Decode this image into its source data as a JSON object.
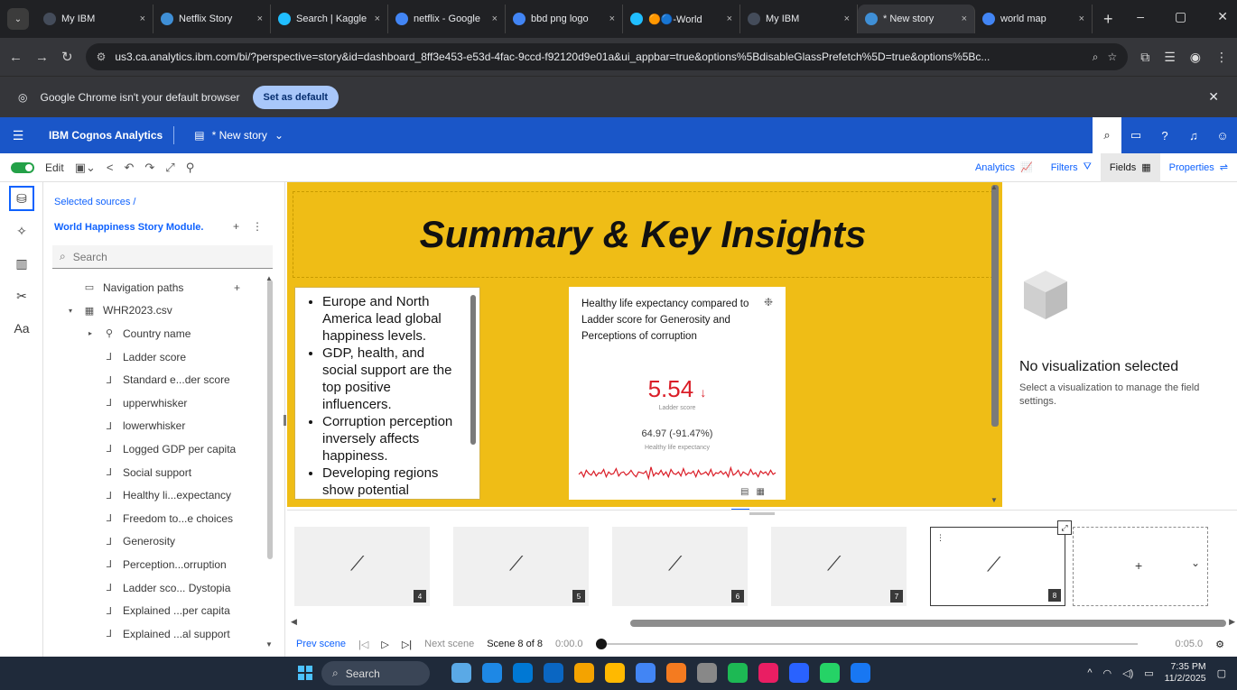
{
  "browser": {
    "tabs": [
      {
        "label": "My IBM",
        "color": "#444c5a",
        "active": false
      },
      {
        "label": "Netflix Story",
        "color": "#3f8fd6",
        "active": false
      },
      {
        "label": "Search | Kaggle",
        "color": "#20beff",
        "active": false
      },
      {
        "label": "netflix - Google",
        "color": "#4285f4",
        "active": false
      },
      {
        "label": "bbd png logo",
        "color": "#4285f4",
        "active": false
      },
      {
        "label": "🟠🔵-World",
        "color": "#20beff",
        "active": false
      },
      {
        "label": "My IBM",
        "color": "#444c5a",
        "active": false
      },
      {
        "label": "* New story",
        "color": "#3f8fd6",
        "active": true
      },
      {
        "label": "world map",
        "color": "#4285f4",
        "active": false
      }
    ],
    "tab_close": "×",
    "new_tab": "+",
    "window_controls": [
      "–",
      "▢",
      "✕"
    ],
    "url": "us3.ca.analytics.ibm.com/bi/?perspective=story&id=dashboard_8ff3e453-e53d-4fac-9ccd-f92120d9e01a&ui_appbar=true&options%5BdisableGlassPrefetch%5D=true&options%5Bc...",
    "infobar_text": "Google Chrome isn't your default browser",
    "set_default_label": "Set as default"
  },
  "app": {
    "product": "IBM Cognos Analytics",
    "story_name": "* New story"
  },
  "toolbar": {
    "edit_label": "Edit",
    "tabs": [
      {
        "label": "Analytics",
        "icon": "📈",
        "active": false
      },
      {
        "label": "Filters",
        "icon": "⛛",
        "active": false
      },
      {
        "label": "Fields",
        "icon": "▦",
        "active": true
      },
      {
        "label": "Properties",
        "icon": "⇌",
        "active": false
      }
    ]
  },
  "sources": {
    "breadcrumb": "Selected sources /",
    "module": "World Happiness Story Module.",
    "search_placeholder": "Search",
    "tree": [
      {
        "label": "Navigation paths",
        "indent": 0,
        "icon": "▭",
        "arrow": "",
        "plus": true
      },
      {
        "label": "WHR2023.csv",
        "indent": 0,
        "icon": "▦",
        "arrow": "▾"
      },
      {
        "label": "Country name",
        "indent": 1,
        "icon": "⚲",
        "arrow": "▸"
      },
      {
        "label": "Ladder score",
        "indent": 1,
        "icon": "⅃",
        "arrow": ""
      },
      {
        "label": "Standard e...der score",
        "indent": 1,
        "icon": "⅃",
        "arrow": ""
      },
      {
        "label": "upperwhisker",
        "indent": 1,
        "icon": "⅃",
        "arrow": ""
      },
      {
        "label": "lowerwhisker",
        "indent": 1,
        "icon": "⅃",
        "arrow": ""
      },
      {
        "label": "Logged GDP per capita",
        "indent": 1,
        "icon": "⅃",
        "arrow": ""
      },
      {
        "label": "Social support",
        "indent": 1,
        "icon": "⅃",
        "arrow": ""
      },
      {
        "label": "Healthy li...expectancy",
        "indent": 1,
        "icon": "⅃",
        "arrow": ""
      },
      {
        "label": "Freedom to...e choices",
        "indent": 1,
        "icon": "⅃",
        "arrow": ""
      },
      {
        "label": "Generosity",
        "indent": 1,
        "icon": "⅃",
        "arrow": ""
      },
      {
        "label": "Perception...orruption",
        "indent": 1,
        "icon": "⅃",
        "arrow": ""
      },
      {
        "label": "Ladder sco... Dystopia",
        "indent": 1,
        "icon": "⅃",
        "arrow": ""
      },
      {
        "label": "Explained ...per capita",
        "indent": 1,
        "icon": "⅃",
        "arrow": ""
      },
      {
        "label": "Explained ...al support",
        "indent": 1,
        "icon": "⅃",
        "arrow": ""
      }
    ]
  },
  "canvas": {
    "title": "Summary & Key Insights",
    "bullets": [
      "Europe and North America lead global happiness levels.",
      "GDP, health, and social support are the top positive influencers.",
      "Corruption perception inversely affects happiness.",
      "Developing regions show potential"
    ],
    "viz": {
      "title": "Healthy life expectancy compared to Ladder score for Generosity and Perceptions of corruption",
      "value": "5.54",
      "value_arrow": "↓",
      "value_label": "Ladder score",
      "sub_value": "64.97 (-91.47%)",
      "sub_label": "Healthy life expectancy",
      "trend_color": "#da1e28",
      "trend": [
        0.45,
        0.6,
        0.3,
        0.7,
        0.5,
        0.4,
        0.65,
        0.35,
        0.55,
        0.5,
        0.75,
        0.3,
        0.6,
        0.45,
        0.5,
        0.8,
        0.35,
        0.55,
        0.6,
        0.4,
        0.5,
        0.7,
        0.45,
        0.3,
        0.6,
        0.55,
        0.5,
        0.65,
        0.2,
        0.9,
        0.35,
        0.55,
        0.45,
        0.7,
        0.4,
        0.6,
        0.3,
        0.75,
        0.5,
        0.45,
        0.6,
        0.35,
        0.8,
        0.4,
        0.55,
        0.5,
        0.65,
        0.3,
        0.7,
        0.45,
        0.5,
        0.6,
        0.4,
        0.75,
        0.35,
        0.55,
        0.5,
        0.65,
        0.45,
        0.6,
        0.3,
        0.85,
        0.4,
        0.5,
        0.7,
        0.35,
        0.6,
        0.5,
        0.4,
        0.75,
        0.45,
        0.55,
        0.3,
        0.65,
        0.5,
        0.6,
        0.4,
        0.7,
        0.45,
        0.55
      ]
    }
  },
  "properties": {
    "title": "No visualization selected",
    "description": "Select a visualization to manage the field settings."
  },
  "scenes": {
    "items": [
      {
        "num": "4",
        "current": false
      },
      {
        "num": "5",
        "current": false
      },
      {
        "num": "6",
        "current": false
      },
      {
        "num": "7",
        "current": false
      },
      {
        "num": "8",
        "current": true
      }
    ],
    "add_label": "+",
    "add_menu": "⌄"
  },
  "playback": {
    "prev": "Prev scene",
    "next": "Next scene",
    "scene_count": "Scene 8 of 8",
    "time_start": "0:00.0",
    "time_end": "0:05.0"
  },
  "taskbar": {
    "search_label": "Search",
    "apps": [
      "#5aa9e6",
      "#1e88e5",
      "#0078d4",
      "#0a66c2",
      "#f4a300",
      "#ffb900",
      "#4285f4",
      "#f47b20",
      "#888888",
      "#1db954",
      "#e91e63",
      "#2962ff",
      "#25d366",
      "#1877f2"
    ],
    "time": "7:35 PM",
    "date": "11/2/2025"
  }
}
